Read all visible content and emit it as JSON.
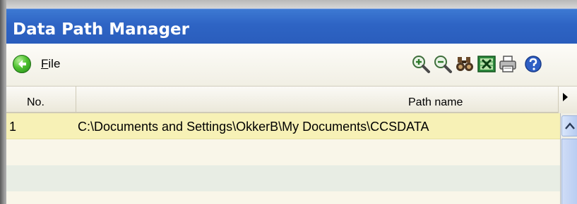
{
  "window": {
    "title": "Data Path Manager"
  },
  "toolbar": {
    "file_menu_first": "F",
    "file_menu_rest": "ile",
    "icons": [
      "back-arrow-icon",
      "zoom-in-icon",
      "zoom-out-icon",
      "find-icon",
      "export-excel-icon",
      "print-icon",
      "help-icon"
    ]
  },
  "table": {
    "columns": [
      "No.",
      "Path name"
    ],
    "rows": [
      {
        "no": "1",
        "path": "C:\\Documents and Settings\\OkkerB\\My Documents\\CCSDATA"
      }
    ]
  },
  "colors": {
    "title_bar": "#2e64c4",
    "selected_row": "#f7f1b6",
    "alt_row": "#e8ede4"
  }
}
